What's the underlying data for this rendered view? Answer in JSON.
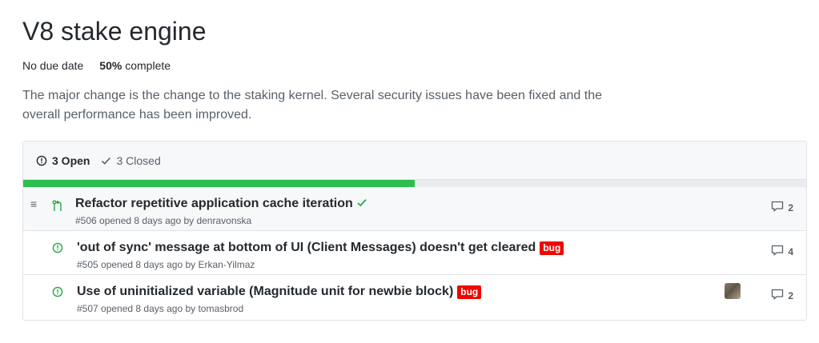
{
  "milestone": {
    "title": "V8 stake engine",
    "due": "No due date",
    "percent": "50%",
    "percent_suffix": "complete",
    "progress_fraction": 0.5,
    "description": "The major change is the change to the staking kernel. Several security issues have been fixed and the overall performance has been improved."
  },
  "states": {
    "open_label": "3 Open",
    "closed_label": "3 Closed"
  },
  "issues": [
    {
      "type": "pull-request",
      "title": "Refactor repetitive application cache iteration",
      "status_check": "success",
      "label": null,
      "meta": "#506 opened 8 days ago by denravonska",
      "comments": "2"
    },
    {
      "type": "issue",
      "title": "'out of sync' message at bottom of UI (Client Messages) doesn't get cleared",
      "label": "bug",
      "meta": "#505 opened 8 days ago by Erkan-Yilmaz",
      "comments": "4"
    },
    {
      "type": "issue",
      "title": "Use of uninitialized variable (Magnitude unit for newbie block)",
      "label": "bug",
      "meta": "#507 opened 8 days ago by tomasbrod",
      "comments": "2",
      "has_assignee_avatar": true
    }
  ],
  "colors": {
    "progress_fill": "#2cbe4e",
    "open_icon": "#28a745",
    "bug_label": "#ee0701"
  }
}
